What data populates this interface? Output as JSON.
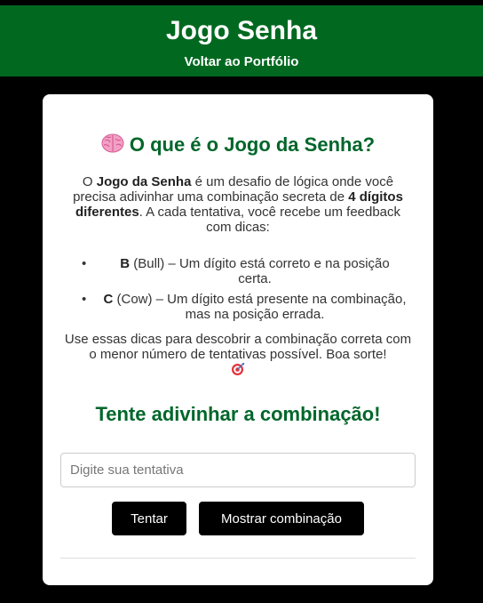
{
  "header": {
    "title": "Jogo Senha",
    "back_link": "Voltar ao Portfólio"
  },
  "intro": {
    "heading": "O que é o Jogo da Senha?",
    "heading_icon": "brain-icon",
    "desc_1": "O ",
    "desc_bold_1": "Jogo da Senha",
    "desc_2": " é um desafio de lógica onde você precisa adivinhar uma combinação secreta de ",
    "desc_bold_2": "4 dígitos diferentes",
    "desc_3": ". A cada tentativa, você recebe um feedback com dicas:",
    "rules": [
      {
        "letter": "B",
        "text": " (Bull) – Um dígito está correto e na posição certa."
      },
      {
        "letter": "C",
        "text": " (Cow) – Um dígito está presente na combinação, mas na posição errada."
      }
    ],
    "tip": "Use essas dicas para descobrir a combinação correta com o menor número de tentativas possível. Boa sorte!",
    "tip_icon": "target-icon"
  },
  "game": {
    "heading": "Tente adivinhar a combinação!",
    "input_placeholder": "Digite sua tentativa",
    "input_value": "",
    "try_button": "Tentar",
    "show_button": "Mostrar combinação"
  },
  "colors": {
    "header_bg": "#00691f",
    "heading_green": "#00662a",
    "page_bg": "#000000",
    "button_bg": "#000000"
  }
}
